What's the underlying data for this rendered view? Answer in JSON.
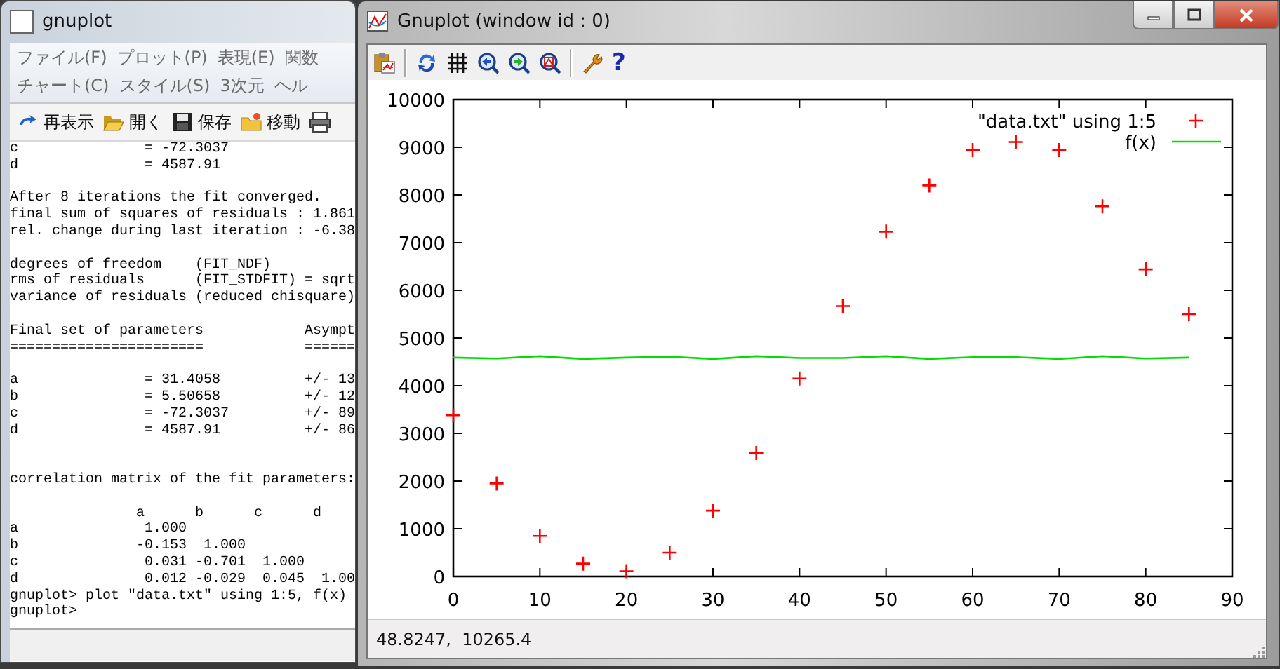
{
  "console_window": {
    "title": "gnuplot",
    "menu_rows": [
      [
        "ファイル(F)",
        "プロット(P)",
        "表現(E)",
        "関数"
      ],
      [
        "チャート(C)",
        "スタイル(S)",
        "3次元",
        "ヘル"
      ]
    ],
    "toolbar": [
      {
        "kind": "refresh",
        "label": "再表示"
      },
      {
        "kind": "open",
        "label": "開く"
      },
      {
        "kind": "save",
        "label": "保存"
      },
      {
        "kind": "move",
        "label": "移動"
      },
      {
        "kind": "print"
      }
    ],
    "lines": [
      {
        "kind": "text",
        "text": "c               = -72.3037"
      },
      {
        "kind": "text",
        "text": "d               = 4587.91"
      },
      {
        "kind": "blank"
      },
      {
        "kind": "text",
        "text": "After 8 iterations the fit converged."
      },
      {
        "kind": "text",
        "text": "final sum of squares of residuals : 1.861"
      },
      {
        "kind": "text",
        "text": "rel. change during last iteration : -6.38"
      },
      {
        "kind": "blank"
      },
      {
        "kind": "text",
        "text": "degrees of freedom    (FIT_NDF)"
      },
      {
        "kind": "text",
        "text": "rms of residuals      (FIT_STDFIT) = sqrt"
      },
      {
        "kind": "text",
        "text": "variance of residuals (reduced chisquare)"
      },
      {
        "kind": "blank"
      },
      {
        "kind": "text",
        "text": "Final set of parameters            Asympt"
      },
      {
        "kind": "text",
        "text": "=======================            ======"
      },
      {
        "kind": "blank"
      },
      {
        "kind": "text",
        "text": "a               = 31.4058          +/- 13"
      },
      {
        "kind": "text",
        "text": "b               = 5.50658          +/- 12"
      },
      {
        "kind": "text",
        "text": "c               = -72.3037         +/- 89"
      },
      {
        "kind": "text",
        "text": "d               = 4587.91          +/- 86"
      },
      {
        "kind": "blank"
      },
      {
        "kind": "blank"
      },
      {
        "kind": "text",
        "text": "correlation matrix of the fit parameters:"
      },
      {
        "kind": "blank"
      },
      {
        "kind": "text",
        "text": "               a      b      c      d"
      },
      {
        "kind": "text",
        "text": "a               1.000"
      },
      {
        "kind": "text",
        "text": "b              -0.153  1.000"
      },
      {
        "kind": "text",
        "text": "c               0.031 -0.701  1.000"
      },
      {
        "kind": "text",
        "text": "d               0.012 -0.029  0.045  1.00"
      },
      {
        "kind": "text",
        "text": "gnuplot> plot \"data.txt\" using 1:5, f(x)"
      },
      {
        "kind": "text",
        "text": "gnuplot>"
      }
    ]
  },
  "plot_window": {
    "title": "Gnuplot (window id : 0)",
    "toolbar": [
      {
        "kind": "copy"
      },
      {
        "kind": "separator"
      },
      {
        "kind": "replot"
      },
      {
        "kind": "grid"
      },
      {
        "kind": "zoom_prev"
      },
      {
        "kind": "zoom_next"
      },
      {
        "kind": "zoom_fit"
      },
      {
        "kind": "separator"
      },
      {
        "kind": "options"
      },
      {
        "kind": "help",
        "glyph": "?"
      }
    ],
    "chart_data": {
      "type": "scatter",
      "x": [
        0,
        5,
        10,
        15,
        20,
        25,
        30,
        35,
        40,
        45,
        50,
        55,
        60,
        65,
        70,
        75,
        80,
        85
      ],
      "series": [
        {
          "name": "\"data.txt\" using 1:5",
          "type": "scatter",
          "color": "#ff0000",
          "values": [
            3380,
            1950,
            850,
            270,
            110,
            500,
            1380,
            2590,
            4150,
            5670,
            7230,
            8200,
            8940,
            9110,
            8940,
            7760,
            6440,
            5500
          ]
        },
        {
          "name": "f(x)",
          "type": "line",
          "color": "#00dd00",
          "values": [
            4590,
            4570,
            4620,
            4560,
            4590,
            4610,
            4560,
            4620,
            4580,
            4580,
            4620,
            4560,
            4600,
            4600,
            4560,
            4620,
            4570,
            4590
          ]
        }
      ],
      "legend": true,
      "xlim": [
        0,
        90
      ],
      "ylim": [
        0,
        10000
      ],
      "xticks": [
        0,
        10,
        20,
        30,
        40,
        50,
        60,
        70,
        80,
        90
      ],
      "yticks": [
        0,
        1000,
        2000,
        3000,
        4000,
        5000,
        6000,
        7000,
        8000,
        9000,
        10000
      ]
    },
    "status_bar": "48.8247,  10265.4"
  }
}
